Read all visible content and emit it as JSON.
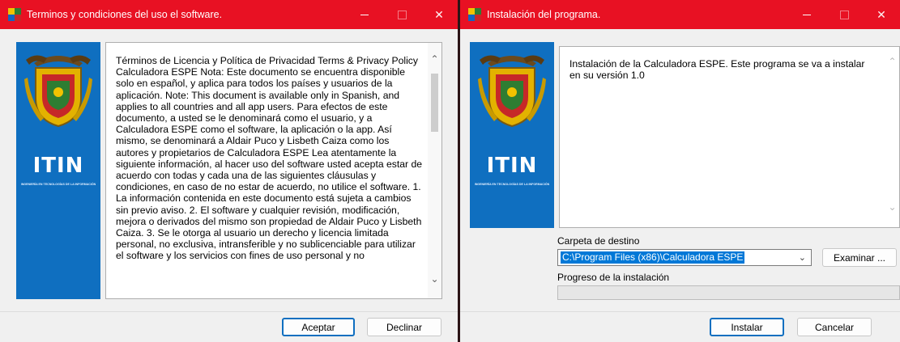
{
  "license_window": {
    "title": "Terminos y condiciones del uso el software.",
    "license_text": "Términos de Licencia y Política de Privacidad Terms & Privacy Policy  Calculadora ESPE Nota: Este documento se encuentra disponible solo en español, y aplica para todos los países y usuarios de la aplicación. Note: This document is available only in Spanish, and applies to all countries and all app users. Para efectos de este documento, a usted se le denominará como el usuario, y a Calculadora ESPE como el software, la aplicación o la app. Así mismo, se denominará a Aldair Puco y Lisbeth Caiza como los autores y propietarios de Calculadora ESPE Lea atentamente la siguiente información, al hacer uso del software usted acepta estar de acuerdo con todas y cada una de las siguientes cláusulas y condiciones, en caso de no estar de acuerdo, no utilice el software. 1. La información contenida en este documento está sujeta a cambios sin previo aviso. 2. El software y cualquier revisión, modificación, mejora o derivados del mismo son propiedad de Aldair Puco y Lisbeth Caiza. 3. Se le otorga al usuario un derecho y licencia limitada personal, no exclusiva, intransferible y no sublicenciable para utilizar el software y los servicios con fines de uso personal y no",
    "accept_label": "Aceptar",
    "decline_label": "Declinar"
  },
  "install_window": {
    "title": "Instalación del programa.",
    "info_text": "Instalación de la Calculadora ESPE. Este programa se va a instalar en su versión 1.0",
    "destination_label": "Carpeta de destino",
    "destination_value": "C:\\Program Files (x86)\\Calculadora ESPE",
    "browse_label": "Examinar ...",
    "progress_label": "Progreso de la instalación",
    "progress_fraction": 0,
    "install_label": "Instalar",
    "cancel_label": "Cancelar"
  },
  "logo": {
    "text": "ITIN",
    "subtext": "INGENIERÍA EN TECNOLOGÍAS DE LA INFORMACIÓN"
  },
  "window_controls": {
    "close": "✕"
  },
  "icons": [
    "app-icon",
    "minimize-icon",
    "maximize-icon",
    "close-icon",
    "scroll-up-icon",
    "scroll-down-icon",
    "chevron-down-icon",
    "shield-logo-icon"
  ],
  "colors": {
    "titlebar": "#e81123",
    "panel": "#0f6fc0",
    "selection": "#0078d7"
  }
}
